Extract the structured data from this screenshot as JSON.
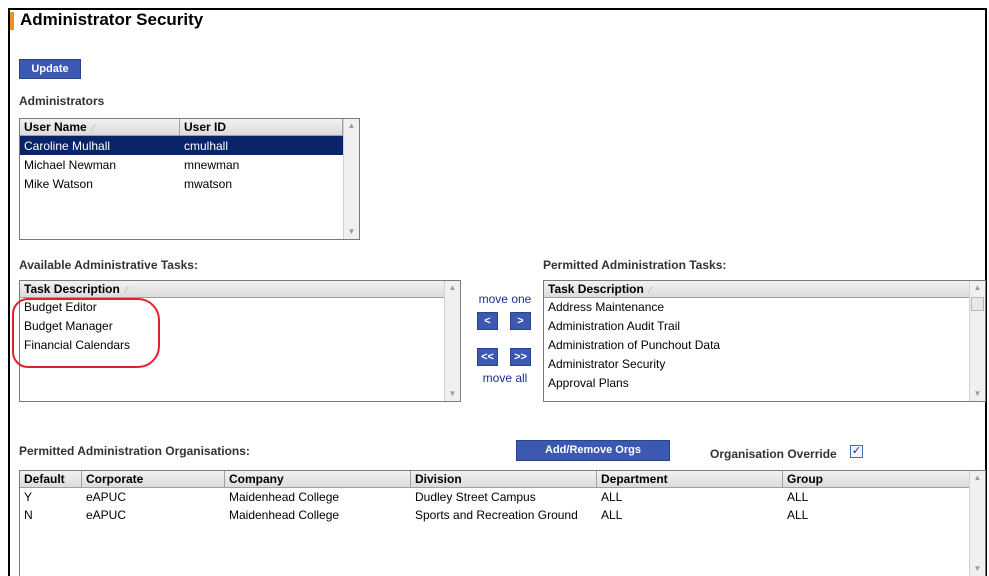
{
  "page": {
    "title": "Administrator Security",
    "update_label": "Update",
    "accent_color": "#f0931e",
    "button_color": "#3b59b0"
  },
  "administrators": {
    "label": "Administrators",
    "columns": [
      "User Name",
      "User ID"
    ],
    "rows": [
      {
        "name": "Caroline Mulhall",
        "id": "cmulhall",
        "selected": true
      },
      {
        "name": "Michael Newman",
        "id": "mnewman",
        "selected": false
      },
      {
        "name": "Mike Watson",
        "id": "mwatson",
        "selected": false
      }
    ]
  },
  "available_tasks": {
    "label": "Available Administrative Tasks:",
    "column": "Task Description",
    "items": [
      "Budget Editor",
      "Budget Manager",
      "Financial Calendars"
    ]
  },
  "move": {
    "move_one": "move one",
    "move_all": "move all",
    "left": "<",
    "right": ">",
    "all_left": "<<",
    "all_right": ">>"
  },
  "permitted_tasks": {
    "label": "Permitted Administration Tasks:",
    "column": "Task Description",
    "items": [
      "Address Maintenance",
      "Administration Audit Trail",
      "Administration of Punchout Data",
      "Administrator Security",
      "Approval Plans"
    ]
  },
  "orgs": {
    "label": "Permitted Administration Organisations:",
    "add_remove_label": "Add/Remove Orgs",
    "override_label": "Organisation Override",
    "override_checked": true,
    "columns": [
      "Default",
      "Corporate",
      "Company",
      "Division",
      "Department",
      "Group"
    ],
    "rows": [
      [
        "Y",
        "eAPUC",
        "Maidenhead College",
        "Dudley Street Campus",
        "ALL",
        "ALL"
      ],
      [
        "N",
        "eAPUC",
        "Maidenhead College",
        "Sports and Recreation Ground",
        "ALL",
        "ALL"
      ]
    ]
  }
}
